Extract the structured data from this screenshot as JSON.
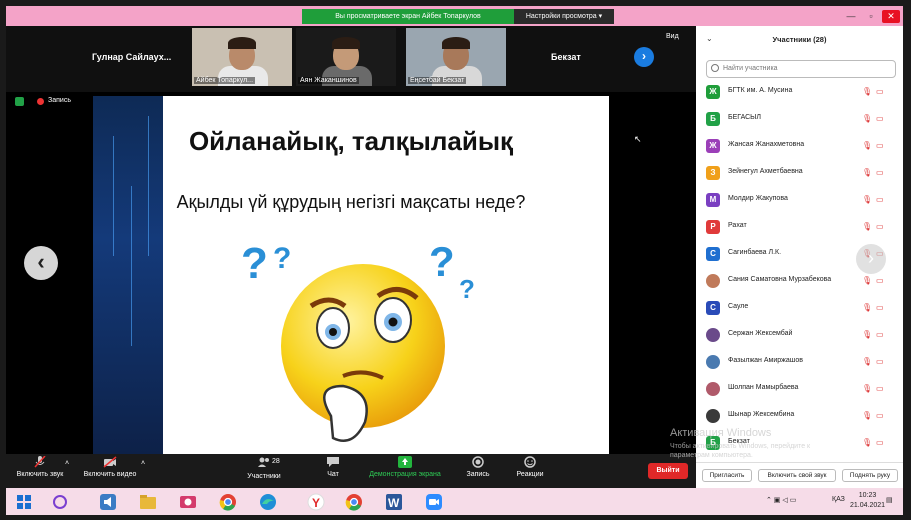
{
  "top_bar": {
    "share_notice": "Вы просматриваете экран Айбек Топаркулов",
    "view_settings": "Настройки просмотра ▾"
  },
  "video_strip": {
    "tiles": [
      {
        "name": "Гулнар Сайлаух..."
      },
      {
        "name": "Айбек Топаркул..."
      },
      {
        "name": "Аян Жаканшинов"
      },
      {
        "name": "Еңсетбай Бекзат"
      },
      {
        "name": "Бекзат"
      }
    ],
    "view_label": "Вид"
  },
  "share": {
    "recording_label": "Запись",
    "slide_title": "Ойланайық, талқылайық",
    "slide_question": "Ақылды үй құрудың негізгі мақсаты неде?"
  },
  "toolbar": {
    "audio": "Включить звук",
    "video": "Включить видео",
    "participants": "Участники",
    "participants_count": "28",
    "chat": "Чат",
    "share_screen": "Демонстрация экрана",
    "record": "Запись",
    "reactions": "Реакции",
    "leave": "Выйти"
  },
  "panel": {
    "title": "Участники (28)",
    "search_placeholder": "Найти участника",
    "participants": [
      {
        "initial": "Ж",
        "name": "БГТК им. А. Мусина",
        "color": "#1f9e3a"
      },
      {
        "initial": "Б",
        "name": "БЕГАСЫЛ",
        "color": "#21a147"
      },
      {
        "initial": "Ж",
        "name": "Жансая Жанахметовна",
        "color": "#9b3fb8"
      },
      {
        "initial": "З",
        "name": "Зейнегул Ахметбаевна",
        "color": "#f0a01a"
      },
      {
        "initial": "М",
        "name": "Молдир Жакупова",
        "color": "#7a3fc1"
      },
      {
        "initial": "Р",
        "name": "Рахат",
        "color": "#e03a3a"
      },
      {
        "initial": "С",
        "name": "Сагинбаева Л.К.",
        "color": "#1f6fd0"
      },
      {
        "initial": "",
        "name": "Сания Саматовна Мурзабекова",
        "color": "#c07a5a"
      },
      {
        "initial": "С",
        "name": "Сауле",
        "color": "#2a4bb8"
      },
      {
        "initial": "",
        "name": "Сержан Жексембай",
        "color": "#6a4a8a"
      },
      {
        "initial": "",
        "name": "Фазылжан Амиржашов",
        "color": "#4a7ab0"
      },
      {
        "initial": "",
        "name": "Шолпан Мамырбаева",
        "color": "#b05a6a"
      },
      {
        "initial": "",
        "name": "Шынар Жексембина",
        "color": "#3a3a3a"
      },
      {
        "initial": "Б",
        "name": "Бекзат",
        "color": "#21a147"
      }
    ],
    "invite": "Пригласить",
    "unmute_me": "Включить свой звук",
    "raise_hand": "Поднять руку"
  },
  "watermark": {
    "line1": "Активация Windows",
    "line2": "Чтобы активировать Windows, перейдите к параметрам компьютера."
  },
  "taskbar": {
    "lang": "ҚАЗ",
    "time": "10:23",
    "date": "21.04.2021"
  }
}
